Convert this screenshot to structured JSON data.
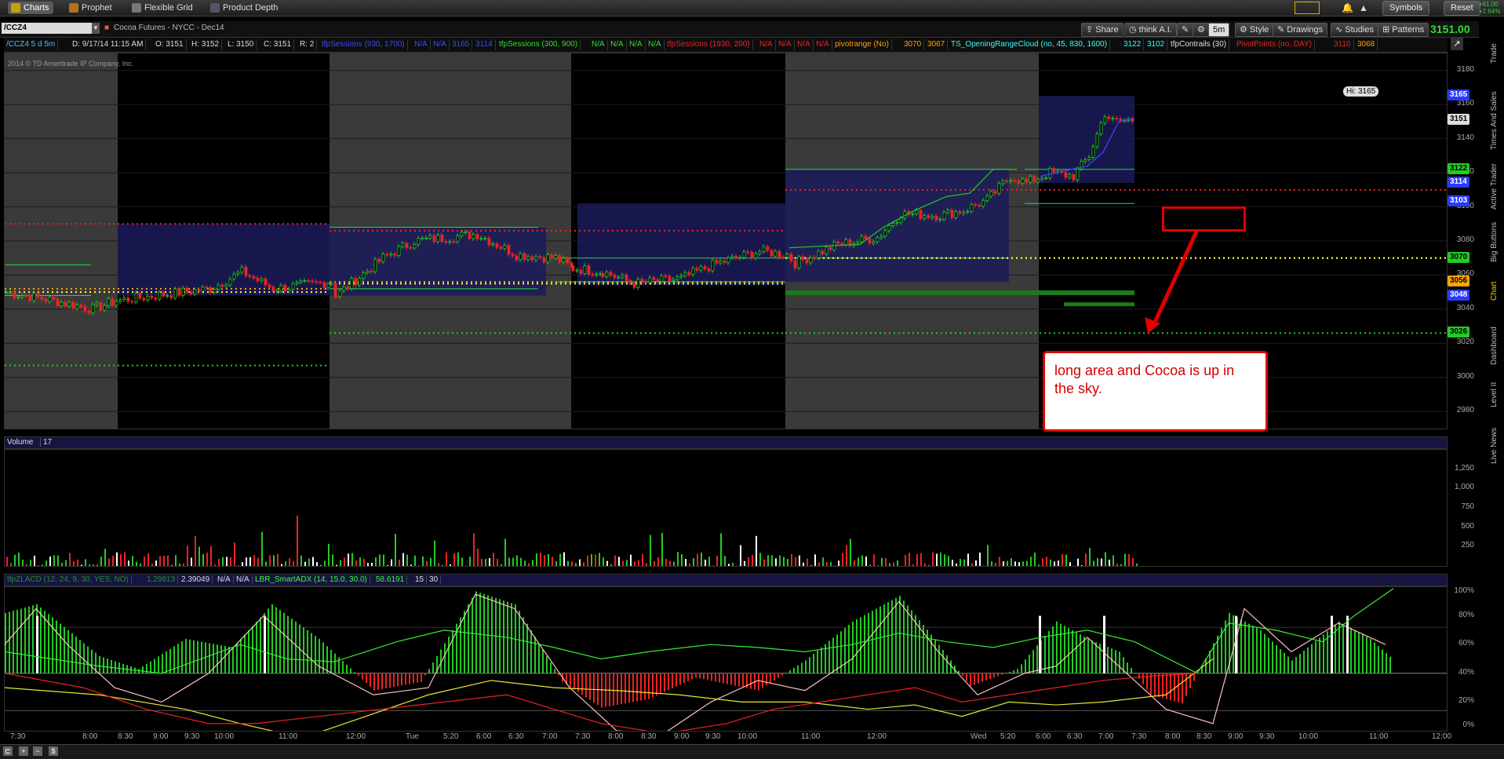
{
  "top_tabs": [
    {
      "label": "Charts",
      "active": true,
      "icon": "chart-icon"
    },
    {
      "label": "Prophet",
      "active": false,
      "icon": "prophet-icon"
    },
    {
      "label": "Flexible Grid",
      "active": false,
      "icon": "grid-icon"
    },
    {
      "label": "Product Depth",
      "active": false,
      "icon": "depth-icon"
    }
  ],
  "top_right": {
    "symbols": "Symbols",
    "reset": "Reset",
    "mini_values": [
      "+81.00",
      "+2.64%"
    ]
  },
  "symbol": "/CCZ4",
  "description": "Cocoa Futures - NYCC - Dec14",
  "toolbar": {
    "share": "Share",
    "think": "think A.I.",
    "interval": "5m",
    "style": "Style",
    "drawings": "Drawings",
    "studies": "Studies",
    "patterns": "Patterns",
    "last_price": "3151.00"
  },
  "info": [
    {
      "text": "/CCZ4 5 d 5m",
      "color": "#4fc3ff"
    },
    {
      "text": "D: 9/17/14 11:15 AM",
      "color": "#ddd"
    },
    {
      "text": "O: 3151",
      "color": "#ddd"
    },
    {
      "text": "H: 3152",
      "color": "#ddd"
    },
    {
      "text": "L: 3150",
      "color": "#ddd"
    },
    {
      "text": "C: 3151",
      "color": "#ddd"
    },
    {
      "text": "R: 2",
      "color": "#ddd"
    },
    {
      "text": "tfpSessions (930, 1700)",
      "color": "#3a4bff"
    },
    {
      "text": "N/A",
      "color": "#3a4bff"
    },
    {
      "text": "N/A",
      "color": "#3a4bff"
    },
    {
      "text": "3165",
      "color": "#3a4bff"
    },
    {
      "text": "3114",
      "color": "#3a4bff"
    },
    {
      "text": "tfpSessions (300, 900)",
      "color": "#33dd33"
    },
    {
      "text": "N/A",
      "color": "#33dd33"
    },
    {
      "text": "N/A",
      "color": "#33dd33"
    },
    {
      "text": "N/A",
      "color": "#33dd33"
    },
    {
      "text": "N/A",
      "color": "#33dd33"
    },
    {
      "text": "tfpSessions (1930, 200)",
      "color": "#e22"
    },
    {
      "text": "N/A",
      "color": "#e22"
    },
    {
      "text": "N/A",
      "color": "#e22"
    },
    {
      "text": "N/A",
      "color": "#e22"
    },
    {
      "text": "N/A",
      "color": "#e22"
    },
    {
      "text": "pivotrange (No)",
      "color": "#ffa500"
    },
    {
      "text": "3070",
      "color": "#ffa500"
    },
    {
      "text": "3067",
      "color": "#ffa500"
    },
    {
      "text": "TS_OpeningRangeCloud (no, 45, 830, 1600)",
      "color": "#33ffff"
    },
    {
      "text": "3122",
      "color": "#33ffff"
    },
    {
      "text": "3102",
      "color": "#33ffff"
    },
    {
      "text": "tfpContrails (30)",
      "color": "#ddd"
    },
    {
      "text": "PivotPoints (no, DAY)",
      "color": "#e22"
    },
    {
      "text": "3110",
      "color": "#e22"
    },
    {
      "text": "3068",
      "color": "#ffa500"
    }
  ],
  "copyright": "2014 © TD Ameritrade IP Company, Inc.",
  "price_axis": [
    "3180",
    "3160",
    "3140",
    "3120",
    "3100",
    "3080",
    "3060",
    "3040",
    "3020",
    "3000",
    "2980"
  ],
  "price_boxes": [
    {
      "text": "3165",
      "bg": "#2a3bff",
      "fg": "#fff"
    },
    {
      "text": "3151",
      "bg": "#ddd",
      "fg": "#000"
    },
    {
      "text": "3122",
      "bg": "#22cc22",
      "fg": "#000"
    },
    {
      "text": "3114",
      "bg": "#2a3bff",
      "fg": "#fff"
    },
    {
      "text": "3103",
      "bg": "#2a3bff",
      "fg": "#fff"
    },
    {
      "text": "3070",
      "bg": "#22cc22",
      "fg": "#000"
    },
    {
      "text": "3056",
      "bg": "#ffa500",
      "fg": "#000"
    },
    {
      "text": "3048",
      "bg": "#2a3bff",
      "fg": "#fff"
    },
    {
      "text": "3026",
      "bg": "#22cc22",
      "fg": "#000"
    }
  ],
  "hi_label": "Hi: 3165",
  "annotation": "long area and Cocoa is up in the sky.",
  "volume": {
    "label": "Volume",
    "value": "17",
    "axis": [
      "1,250",
      "1,000",
      "750",
      "500",
      "250"
    ]
  },
  "lower_study": {
    "labels": [
      {
        "text": "tfpZLACD (12, 24, 9, 30, YES, NO)",
        "color": "#2a8a2a"
      },
      {
        "text": "1.29813",
        "color": "#2a8a2a"
      },
      {
        "text": "2.39049",
        "color": "#ddd"
      },
      {
        "text": "N/A",
        "color": "#ddd"
      },
      {
        "text": "N/A",
        "color": "#ddd"
      },
      {
        "text": "LBR_SmartADX (14, 15.0, 30.0)",
        "color": "#33ff33"
      },
      {
        "text": "58.6191",
        "color": "#33ff33"
      },
      {
        "text": "15",
        "color": "#ddd"
      },
      {
        "text": "30",
        "color": "#ddd"
      }
    ],
    "axis": [
      "100%",
      "80%",
      "60%",
      "40%",
      "20%",
      "0%"
    ]
  },
  "time_labels": [
    "7:30",
    "8:00",
    "8:30",
    "9:00",
    "9:30",
    "10:00",
    "11:00",
    "12:00",
    "Tue",
    "5:20",
    "6:00",
    "6:30",
    "7:00",
    "7:30",
    "8:00",
    "8:30",
    "9:00",
    "9:30",
    "10:00",
    "11:00",
    "12:00",
    "Wed",
    "5:20",
    "6:00",
    "6:30",
    "7:00",
    "7:30",
    "8:00",
    "8:30",
    "9:00",
    "9:30",
    "10:00",
    "11:00",
    "12:00"
  ],
  "side_tabs": [
    "Trade",
    "Times And Sales",
    "Active Trader",
    "Big Buttons",
    "Chart",
    "Dashboard",
    "Level II",
    "Live News"
  ],
  "colors": {
    "session_gray": "#3a3a3a",
    "band_blue": "#1b1b5a",
    "green": "#22cc22",
    "red": "#e22",
    "orange": "#ffa500"
  }
}
